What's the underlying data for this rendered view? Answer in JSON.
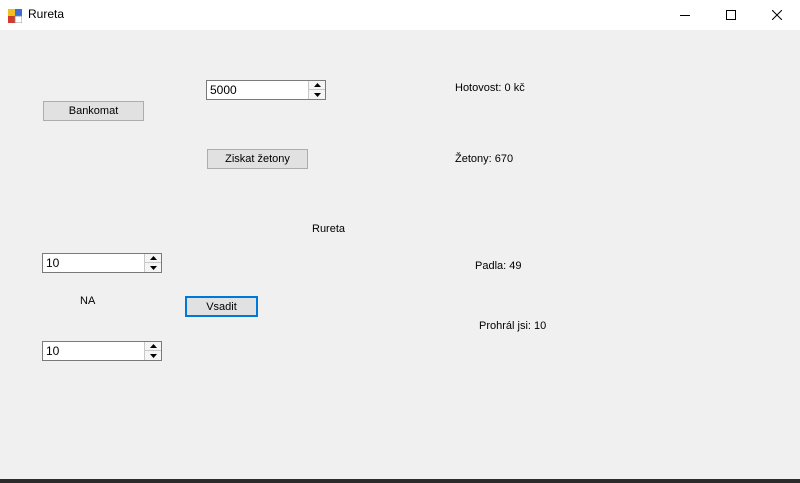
{
  "window": {
    "title": "Rureta"
  },
  "atm": {
    "button_label": "Bankomat",
    "amount_value": "5000",
    "get_chips_label": "Ziskat žetony",
    "cash_label": "Hotovost: 0 kč",
    "chips_label": "Žetony: 670"
  },
  "game": {
    "title": "Rureta",
    "bet_amount_value": "10",
    "on_label": "NA",
    "bet_button_label": "Vsadit",
    "bet_number_value": "10",
    "result_label": "Padla: 49",
    "outcome_label": "Prohrál jsi: 10"
  },
  "icons": {
    "app": "roulette-app-icon",
    "minimize": "minimize-icon",
    "maximize": "maximize-icon",
    "close": "close-icon",
    "spin_up": "chevron-up-icon",
    "spin_down": "chevron-down-icon"
  },
  "colors": {
    "form_background": "#f0f0f0",
    "focus_accent": "#0078d7"
  }
}
